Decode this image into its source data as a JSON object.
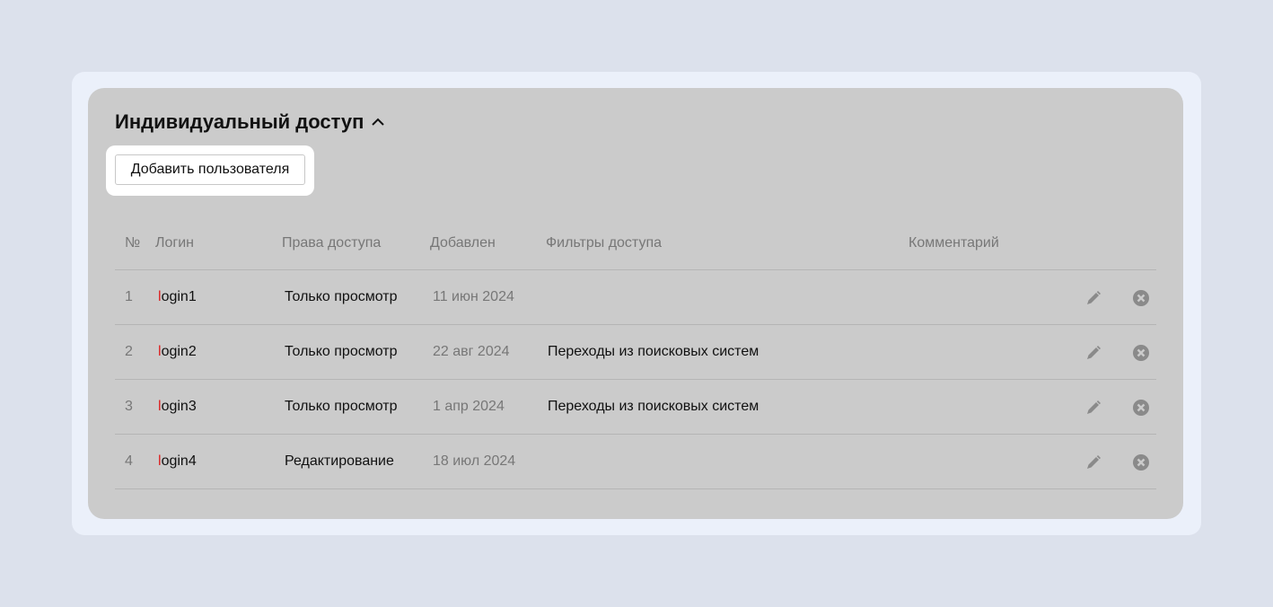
{
  "section": {
    "title": "Индивидуальный доступ",
    "add_button_label": "Добавить пользователя"
  },
  "table": {
    "columns": {
      "num": "№",
      "login": "Логин",
      "rights": "Права доступа",
      "added": "Добавлен",
      "filters": "Фильтры доступа",
      "comment": "Комментарий"
    },
    "rows": [
      {
        "num": "1",
        "login_first": "l",
        "login_rest": "ogin1",
        "rights": "Только просмотр",
        "added": "11 июн 2024",
        "filters": "",
        "comment": ""
      },
      {
        "num": "2",
        "login_first": "l",
        "login_rest": "ogin2",
        "rights": "Только просмотр",
        "added": "22 авг 2024",
        "filters": "Переходы из поисковых систем",
        "comment": ""
      },
      {
        "num": "3",
        "login_first": "l",
        "login_rest": "ogin3",
        "rights": "Только просмотр",
        "added": "1 апр 2024",
        "filters": "Переходы из поисковых систем",
        "comment": ""
      },
      {
        "num": "4",
        "login_first": "l",
        "login_rest": "ogin4",
        "rights": "Редактирование",
        "added": "18 июл 2024",
        "filters": "",
        "comment": ""
      }
    ]
  },
  "icons": {
    "collapse": "chevron-up-icon",
    "edit": "pencil-icon",
    "delete": "close-circle-icon"
  },
  "colors": {
    "page_bg": "#dce1ec",
    "outer_bg": "#ebf0fa",
    "panel_bg": "#cbcbcb",
    "login_accent": "#dd2222",
    "icon_gray": "#8a8a8a"
  }
}
